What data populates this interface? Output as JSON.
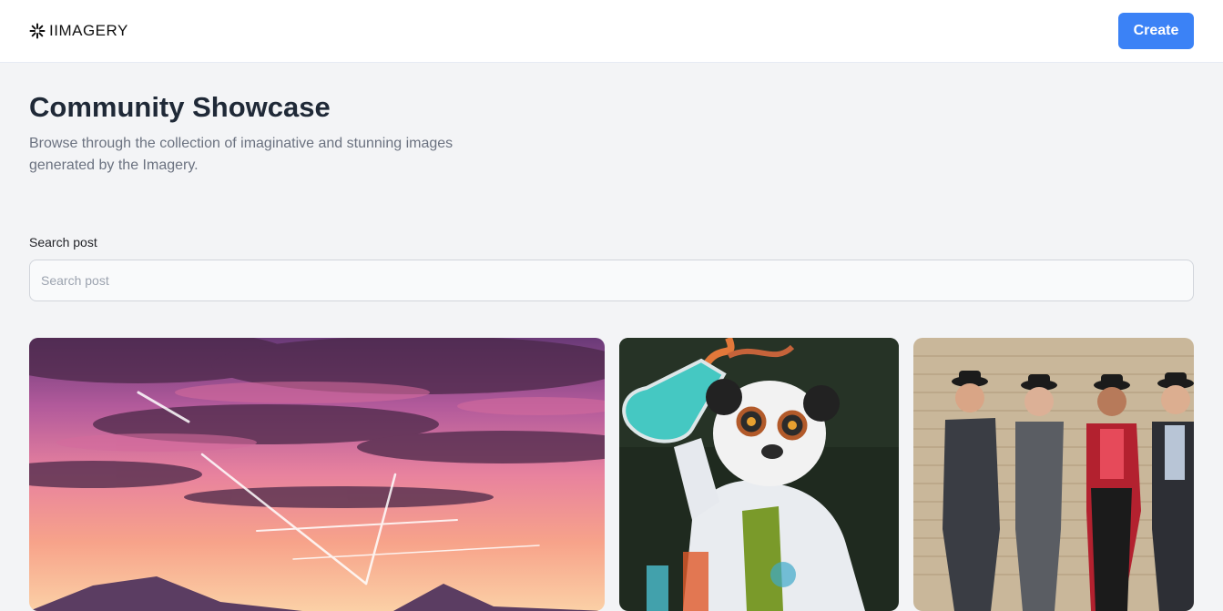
{
  "header": {
    "logo_text": "IIMAGERY",
    "logo_icon": "sparkle-icon",
    "create_label": "Create",
    "accent_color": "#3b82f6"
  },
  "main": {
    "title": "Community Showcase",
    "subtitle": "Browse through the collection of imaginative and stunning images generated by the Imagery.",
    "search": {
      "label": "Search post",
      "placeholder": "Search post",
      "value": ""
    },
    "posts": [
      {
        "subject": "sunset-sky-with-contrails"
      },
      {
        "subject": "panda-scientist-with-flask"
      },
      {
        "subject": "group-with-bowler-hats-brick-wall"
      }
    ]
  }
}
